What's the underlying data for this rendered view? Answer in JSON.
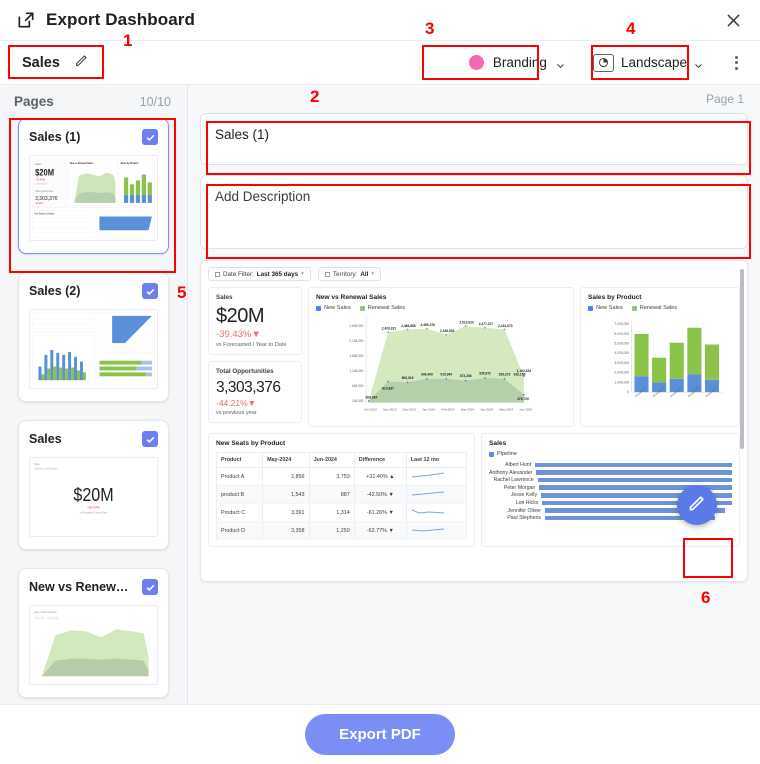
{
  "header": {
    "title": "Export Dashboard",
    "open_icon": "open-in-new-icon",
    "close_icon": "close-icon"
  },
  "toolbar": {
    "doc_name": "Sales",
    "edit_icon": "pencil-icon",
    "branding_label": "Branding",
    "branding_color": "#f368b0",
    "orientation_label": "Landscape",
    "orientation_icon": "page-orientation-icon",
    "more_icon": "kebab-menu-icon"
  },
  "sidebar": {
    "header_label": "Pages",
    "count": "10/10",
    "pages": [
      {
        "title": "Sales (1)",
        "checked": true,
        "selected": true
      },
      {
        "title": "Sales (2)",
        "checked": true,
        "selected": false
      },
      {
        "title": "Sales",
        "checked": true,
        "selected": false
      },
      {
        "title": "New vs Renewal S...",
        "checked": true,
        "selected": false
      }
    ]
  },
  "preview": {
    "page_label": "Page 1",
    "title_value": "Sales (1)",
    "description_placeholder": "Add Description",
    "fab_icon": "pencil-icon"
  },
  "dashboard": {
    "filters": [
      {
        "label": "Date Filter:",
        "value": "Last 365 days"
      },
      {
        "label": "Territory:",
        "value": "All"
      }
    ],
    "kpis": [
      {
        "label": "Sales",
        "value": "$20M",
        "delta": "-39.43%",
        "sub": "vs Forecasted / Year to Date"
      },
      {
        "label": "Total Opportunities",
        "value": "3,303,376",
        "delta": "-44.21%",
        "sub": "vs previous year"
      }
    ],
    "table": {
      "title": "New Seats by Product",
      "columns": [
        "Product",
        "May-2024",
        "Jun-2024",
        "Difference",
        "Last 12 mo"
      ],
      "rows": [
        {
          "product": "Product A",
          "may": "2,856",
          "jun": "3,753",
          "diff": "+31.40%",
          "dir": "up"
        },
        {
          "product": "product B",
          "may": "1,543",
          "jun": "887",
          "diff": "-42.50%",
          "dir": "down"
        },
        {
          "product": "Product C",
          "may": "3,391",
          "jun": "1,314",
          "diff": "-61.26%",
          "dir": "down"
        },
        {
          "product": "Product D",
          "may": "3,358",
          "jun": "1,250",
          "diff": "-62.77%",
          "dir": "down"
        }
      ]
    },
    "pipeline": {
      "title": "Sales",
      "legend": "Pipeline",
      "names": [
        "Albert Hunt",
        "Anthony Alexander",
        "Rachel Lawrence",
        "Peter Morgan",
        "Jesse Kelly",
        "Lori Hicks",
        "Jennifer Oliver",
        "Paul Stephens"
      ],
      "widths": [
        100,
        97,
        93,
        89,
        85,
        82,
        74,
        70
      ]
    }
  },
  "chart_data": [
    {
      "type": "area",
      "title": "New vs Renewal Sales",
      "legend": [
        "New Sales",
        "Renewal Sales"
      ],
      "legend_colors": [
        "#4285f4",
        "#93c47d"
      ],
      "x": [
        "Oct-2023",
        "Nov-2023",
        "Dec-2023",
        "Jan-2024",
        "Feb-2024",
        "Mar-2024",
        "Apr-2024",
        "May-2024",
        "Jun-2024"
      ],
      "xlabel": "",
      "ylabel": "",
      "ylim": [
        148000,
        2648000
      ],
      "yticks": [
        "148,000",
        "648,000",
        "1,148,000",
        "1,648,000",
        "2,148,000",
        "2,648,000"
      ],
      "series": [
        {
          "name": "New Sales",
          "values": [
            309034,
            814837,
            806018,
            909499,
            915949,
            873286,
            935872,
            926373,
            916158,
            476729
          ],
          "labels": [
            "309,034",
            "814,837",
            "806,018",
            "909,499",
            "915,949",
            "873,286",
            "935,872",
            "926,373",
            "916,158",
            "476,729"
          ]
        },
        {
          "name": "Renewal Sales",
          "values": [
            309034,
            2420321,
            2466868,
            2489276,
            2349602,
            2513029,
            2477217,
            2431073,
            1192324
          ],
          "labels": [
            "2,420,321",
            "2,466,868",
            "2,489,276",
            "2,349,602",
            "2,513,029",
            "2,477,217",
            "2,431,073",
            "1,192,324"
          ]
        }
      ]
    },
    {
      "type": "bar",
      "title": "Sales by Product",
      "legend": [
        "New Sales",
        "Renewal Sales"
      ],
      "legend_colors": [
        "#4285f4",
        "#93c47d"
      ],
      "categories": [
        "Product A",
        "Product B",
        "Product C",
        "Product D",
        "Product E"
      ],
      "yticks": [
        "0",
        "1,000,000",
        "2,000,000",
        "3,000,000",
        "4,000,000",
        "5,000,000",
        "6,000,000",
        "7,000,000"
      ],
      "ylim": [
        0,
        7000000
      ],
      "series": [
        {
          "name": "New Sales",
          "values": [
            1650000,
            980000,
            1370000,
            1780000,
            1290000
          ]
        },
        {
          "name": "Renewal Sales",
          "values": [
            4370000,
            2540000,
            3760000,
            4820000,
            3600000
          ]
        }
      ]
    }
  ],
  "footer": {
    "export_label": "Export PDF"
  },
  "annotations": [
    {
      "num": "1"
    },
    {
      "num": "2"
    },
    {
      "num": "3"
    },
    {
      "num": "4"
    },
    {
      "num": "5"
    },
    {
      "num": "6"
    }
  ]
}
